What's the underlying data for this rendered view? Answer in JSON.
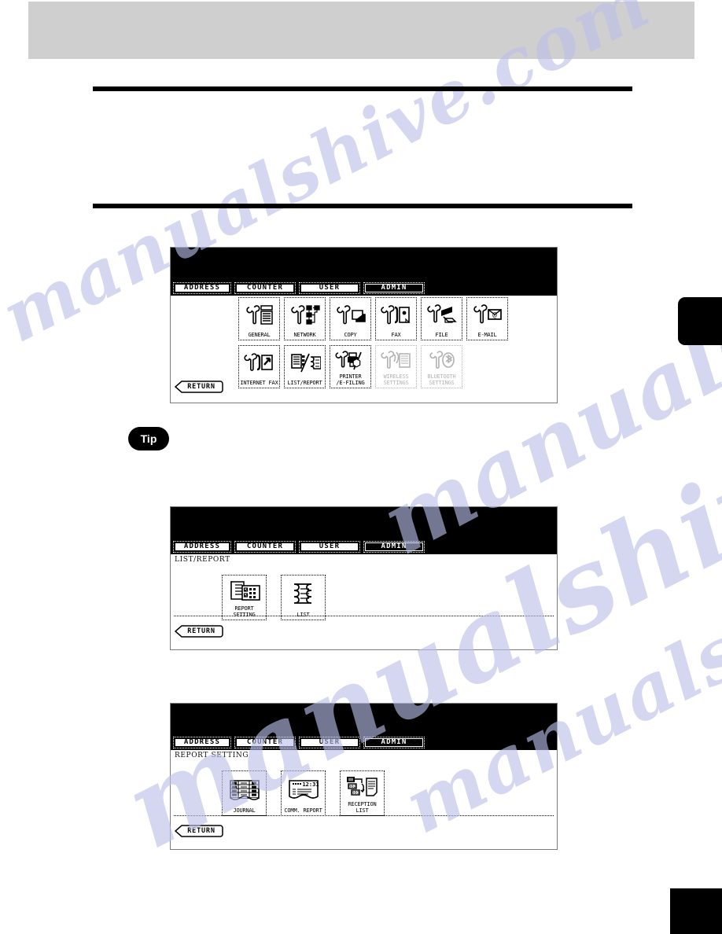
{
  "page": {
    "header_band": "",
    "tip_label": "Tip"
  },
  "lcd_tabs": [
    {
      "label": "ADDRESS",
      "active": false
    },
    {
      "label": "COUNTER",
      "active": false
    },
    {
      "label": "USER",
      "active": false
    },
    {
      "label": "ADMIN",
      "active": true
    }
  ],
  "panels": [
    {
      "name": "admin-menu",
      "breadcrumb": "",
      "return_label": "RETURN",
      "rows": [
        [
          {
            "label": "GENERAL",
            "icon": "wrench-copier-icon",
            "disabled": false
          },
          {
            "label": "NETWORK",
            "icon": "wrench-network-icon",
            "disabled": false
          },
          {
            "label": "COPY",
            "icon": "wrench-copy-icon",
            "disabled": false
          },
          {
            "label": "FAX",
            "icon": "wrench-fax-icon",
            "disabled": false
          },
          {
            "label": "FILE",
            "icon": "wrench-file-icon",
            "disabled": false
          },
          {
            "label": "E-MAIL",
            "icon": "wrench-email-icon",
            "disabled": false
          }
        ],
        [
          {
            "label": "INTERNET FAX",
            "icon": "wrench-internet-fax-icon",
            "disabled": false
          },
          {
            "label": "LIST/REPORT",
            "icon": "list-report-icon",
            "disabled": false
          },
          {
            "label": "PRINTER\n/E-FILING",
            "icon": "wrench-printer-efiling-icon",
            "disabled": false
          },
          {
            "label": "WIRELESS\nSETTINGS",
            "icon": "wrench-wireless-icon",
            "disabled": true
          },
          {
            "label": "BLUETOOTH\nSETTINGS",
            "icon": "wrench-bluetooth-icon",
            "disabled": true
          }
        ]
      ]
    },
    {
      "name": "list-report-menu",
      "breadcrumb": "LIST/REPORT",
      "return_label": "RETURN",
      "rows": [
        [
          {
            "label": "REPORT SETTING",
            "icon": "report-setting-icon",
            "disabled": false
          },
          {
            "label": "LIST",
            "icon": "list-scroll-icon",
            "disabled": false
          }
        ]
      ]
    },
    {
      "name": "report-setting-menu",
      "breadcrumb": "REPORT SETTING",
      "return_label": "RETURN",
      "rows": [
        [
          {
            "label": "JOURNAL",
            "icon": "journal-table-icon",
            "disabled": false
          },
          {
            "label": "COMM. REPORT",
            "icon": "comm-report-icon",
            "disabled": false
          },
          {
            "label": "RECEPTION LIST",
            "icon": "reception-list-icon",
            "disabled": false
          }
        ]
      ]
    }
  ],
  "watermark": {
    "lines": [
      "manualshive.com",
      "manualshive.com",
      "manualshive.com",
      "manualshive.com"
    ]
  },
  "colors": {
    "header_band": "#cfcfcf",
    "rule": "#000000",
    "lcd_black": "#000000",
    "watermark": "#bcc0ea"
  }
}
